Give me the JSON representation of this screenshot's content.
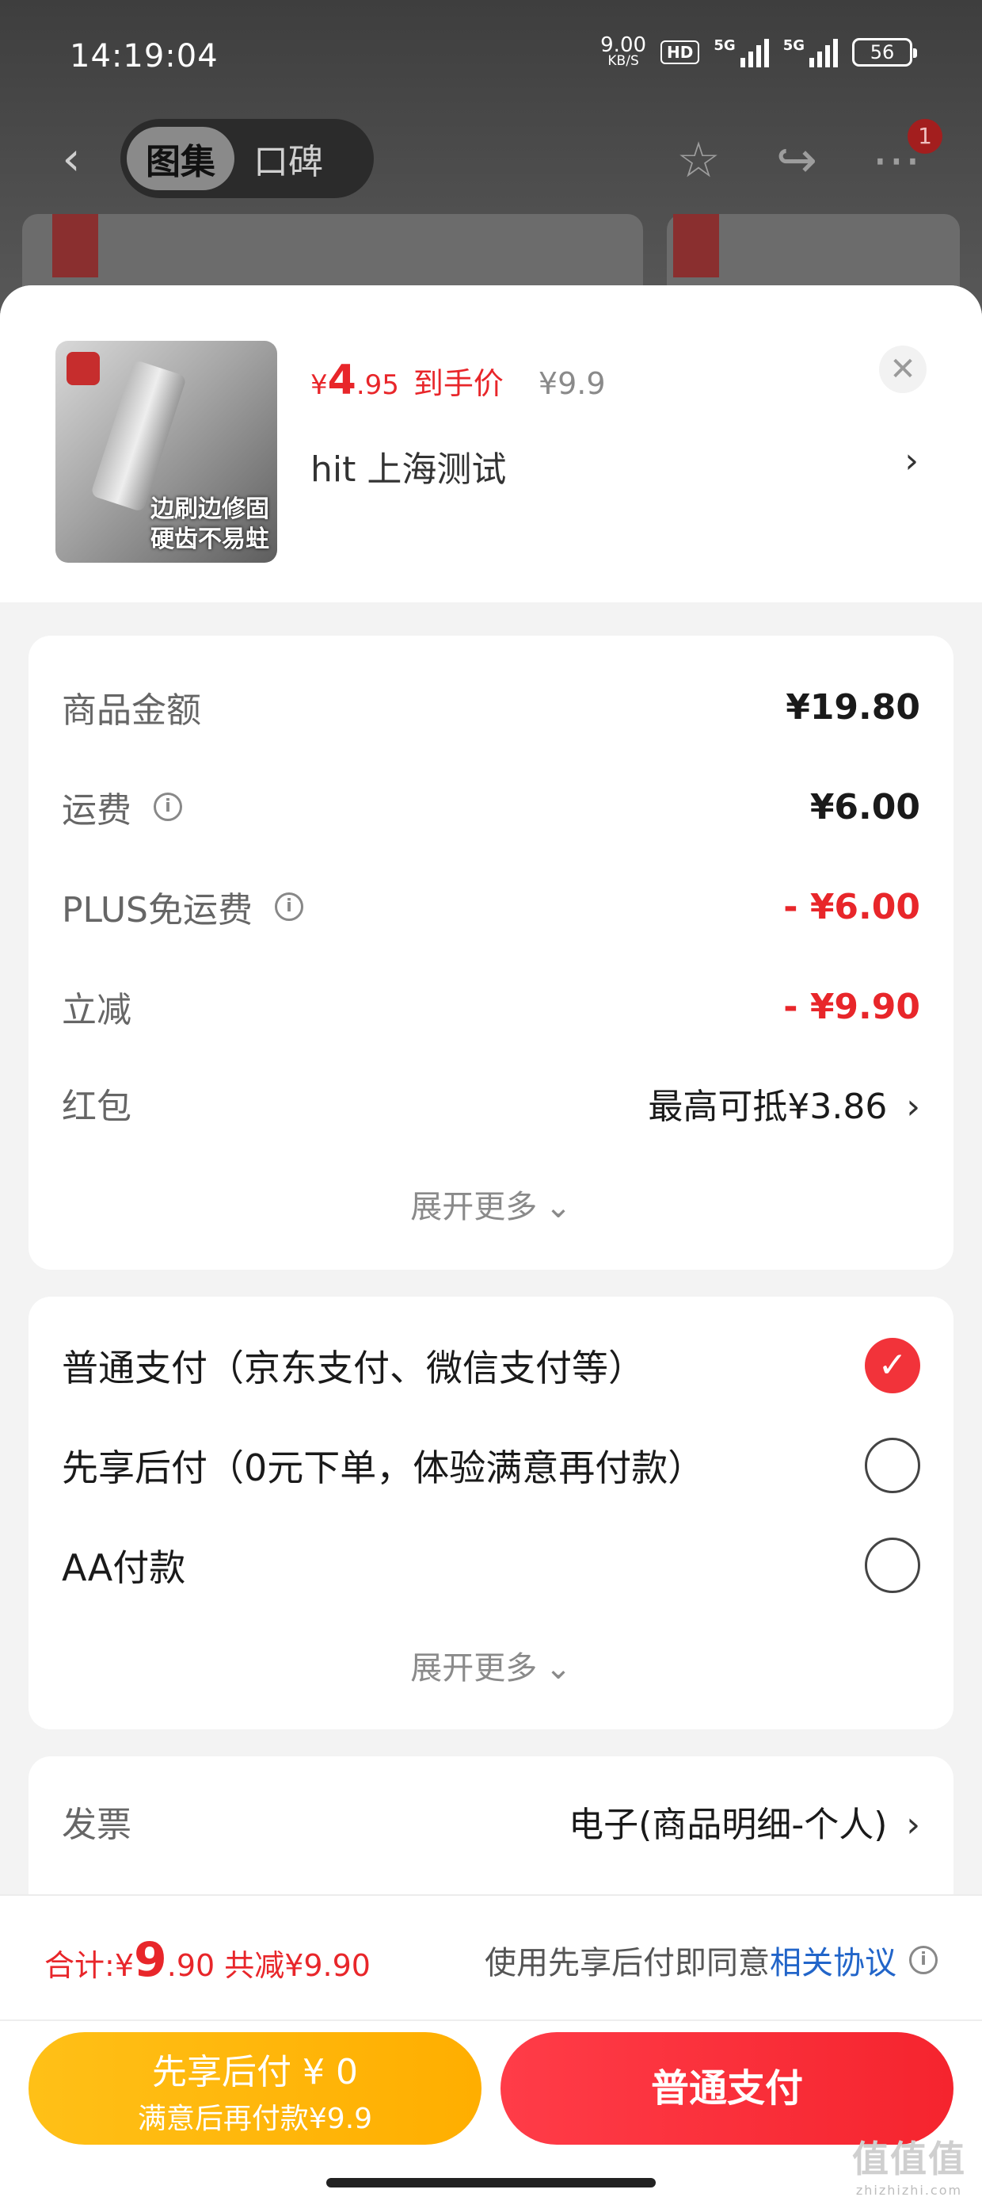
{
  "status_bar": {
    "time": "14:19:04",
    "net_speed": "9.00",
    "net_unit": "KB/S",
    "hd_label": "HD",
    "signal1_label": "5G",
    "signal2_label": "5G",
    "battery": "56"
  },
  "top_nav": {
    "tabs": [
      {
        "label": "图集",
        "active": true
      },
      {
        "label": "口碑",
        "active": false
      }
    ],
    "badge": "1"
  },
  "product": {
    "price_symbol": "¥",
    "price_int": "4",
    "price_dec": ".95",
    "price_tag": "到手价",
    "original_price": "¥9.9",
    "address": "hit  上海测试",
    "image_caption_line1": "边刷边修固",
    "image_caption_line2": "硬齿不易蛀"
  },
  "summary": {
    "rows": [
      {
        "label": "商品金额",
        "value": "¥19.80"
      },
      {
        "label": "运费",
        "value": "¥6.00"
      },
      {
        "label": "PLUS免运费",
        "value": "- ¥6.00"
      },
      {
        "label": "立减",
        "value": "- ¥9.90"
      },
      {
        "label": "红包",
        "value": "最高可抵¥3.86"
      }
    ],
    "expand_label": "展开更多"
  },
  "payment": {
    "options": [
      {
        "label": "普通支付（京东支付、微信支付等）",
        "selected": true
      },
      {
        "label": "先享后付（0元下单，体验满意再付款）",
        "selected": false
      },
      {
        "label": "AA付款",
        "selected": false
      }
    ],
    "expand_label": "展开更多"
  },
  "invoice": {
    "label": "发票",
    "value": "电子(商品明细-个人)"
  },
  "footer": {
    "total_label": "合计: ",
    "total_symbol": "¥",
    "total_int": "9",
    "total_dec": ".90",
    "saved": "共减¥9.90",
    "agree_text": "使用先享后付即同意",
    "agree_link": "相关协议",
    "btn_left_line1": "先享后付 ¥ 0",
    "btn_left_line2": "满意后再付款¥9.9",
    "btn_right": "普通支付"
  },
  "watermark": {
    "main": "值值值",
    "sub": "zhizhizhi.com"
  },
  "colors": {
    "accent_red": "#e8262a",
    "pay_yellow": "#ffb300",
    "link_blue": "#2265c9"
  }
}
